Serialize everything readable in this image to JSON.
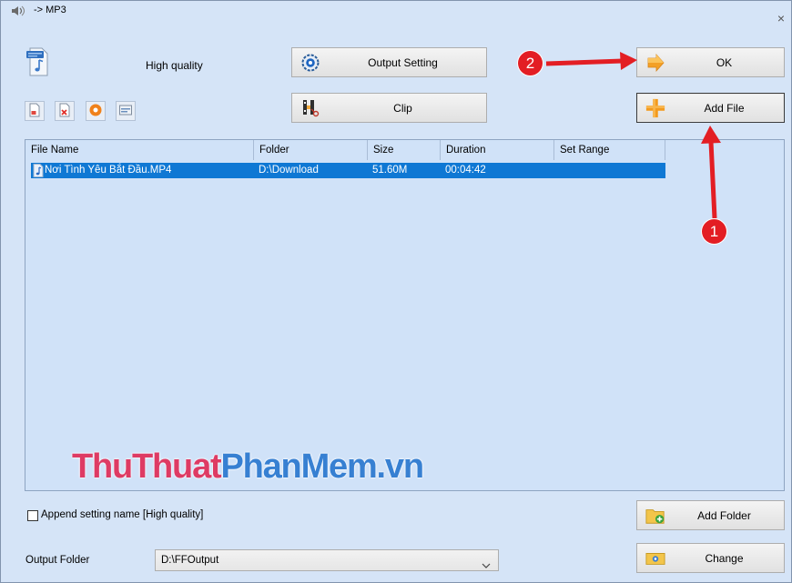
{
  "window": {
    "title": "-> MP3",
    "close_glyph": "×",
    "icon": "speaker-icon"
  },
  "profile": {
    "icon": "mp3-file-icon",
    "quality_label": "High quality"
  },
  "buttons": {
    "output_setting": {
      "label": "Output Setting",
      "icon": "gear-icon"
    },
    "clip": {
      "label": "Clip",
      "icon": "film-clip-icon"
    },
    "ok": {
      "label": "OK",
      "icon": "arrow-right-icon"
    },
    "add_file": {
      "label": "Add File",
      "icon": "plus-icon",
      "focused": true
    },
    "add_folder": {
      "label": "Add Folder",
      "icon": "folder-add-icon"
    },
    "change": {
      "label": "Change",
      "icon": "folder-change-icon"
    }
  },
  "toolbar": {
    "items": [
      {
        "icon": "remove-icon"
      },
      {
        "icon": "delete-icon"
      },
      {
        "icon": "play-icon"
      },
      {
        "icon": "info-icon"
      }
    ]
  },
  "file_list": {
    "columns": [
      "File Name",
      "Folder",
      "Size",
      "Duration",
      "Set Range"
    ],
    "rows": [
      {
        "icon": "audio-file-icon",
        "file_name": "Nơi Tình Yêu Bắt Đầu.MP4",
        "folder": "D:\\Download",
        "size": "51.60M",
        "duration": "00:04:42",
        "set_range": "",
        "selected": true
      }
    ]
  },
  "options": {
    "append_setting_label": "Append setting name [High quality]",
    "append_setting_checked": false
  },
  "output": {
    "label": "Output Folder",
    "folder": "D:\\FFOutput"
  },
  "annotations": [
    {
      "number": "1"
    },
    {
      "number": "2"
    }
  ],
  "watermark": {
    "part1": "ThuThuat",
    "part2": "PhanMem.vn"
  },
  "colors": {
    "window_bg": "#d5e4f7",
    "list_bg": "#d0e2f8",
    "selection": "#0f78d4",
    "annotation": "#e31e24",
    "watermark_part1": "#de3b64",
    "watermark_part2": "#3780d2"
  }
}
